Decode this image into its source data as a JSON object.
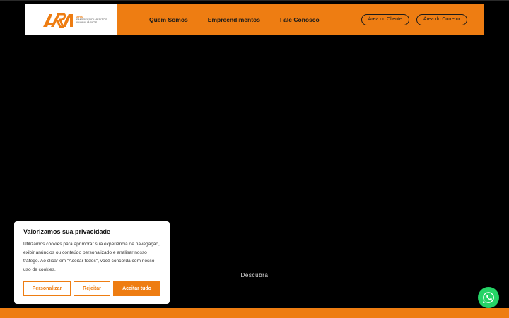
{
  "header": {
    "logo": {
      "brand_text": "ARA",
      "sub_line1": "ARA",
      "sub_line2": "EMPREENDIMENTOS",
      "sub_line3": "IMOBILIÁRIOS"
    },
    "nav": [
      "Quem Somos",
      "Empreendimentos",
      "Fale Conosco"
    ],
    "buttons": {
      "client": "Área do Cliente",
      "broker": "Área do Corretor"
    }
  },
  "cookie_banner": {
    "title": "Valorizamos sua privacidade",
    "body": "Utilizamos cookies para aprimorar sua experiência de navegação, exibir anúncios ou conteúdo personalizado e analisar nosso tráfego. Ao clicar em \"Aceitar todos\", você concorda com nosso uso de cookies.",
    "customize": "Personalizar",
    "reject": "Rejeitar",
    "accept": "Aceitar tudo"
  },
  "hero": {
    "discover_label": "Descubra"
  },
  "colors": {
    "accent": "#ee7d12",
    "background": "#000000",
    "whatsapp": "#25d366"
  },
  "icons": {
    "whatsapp": "whatsapp-icon"
  }
}
